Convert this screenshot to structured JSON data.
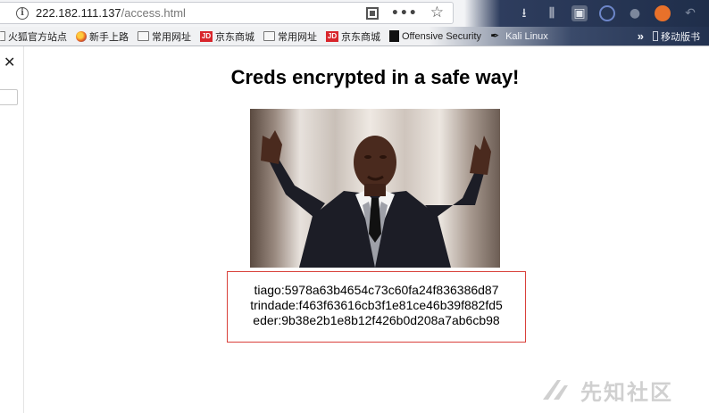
{
  "browser": {
    "url_host": "222.182.111.137",
    "url_path": "/access.html",
    "toolbar_icons": [
      "qr-code-icon",
      "more-icon",
      "bookmark-star-icon",
      "download-icon",
      "library-icon",
      "sidebar-icon",
      "globe-icon",
      "extension-icon",
      "extension-icon",
      "back-icon"
    ]
  },
  "bookmarks": {
    "items": [
      {
        "label": "火狐官方站点",
        "icon": "folder-icon"
      },
      {
        "label": "新手上路",
        "icon": "firefox-icon"
      },
      {
        "label": "常用网址",
        "icon": "folder-icon"
      },
      {
        "label": "京东商城",
        "icon": "jd-icon",
        "icon_text": "JD"
      },
      {
        "label": "常用网址",
        "icon": "folder-icon"
      },
      {
        "label": "京东商城",
        "icon": "jd-icon",
        "icon_text": "JD"
      },
      {
        "label": "Offensive Security",
        "icon": "offensive-security-icon"
      },
      {
        "label": "Kali Linux",
        "icon": "kali-icon"
      }
    ],
    "overflow_label": "»",
    "mobile_label": "移动版书"
  },
  "side_panel": {
    "close_label": "✕"
  },
  "page": {
    "title": "Creds encrypted in a safe way!",
    "image_alt": "man-in-suit-raising-hands",
    "creds": [
      "tiago:5978a63b4654c73c60fa24f836386d87",
      "trindade:f463f63616cb3f1e81ce46b39f882fd5",
      "eder:9b38e2b1e8b12f426b0d208a7ab6cb98"
    ]
  },
  "watermark": {
    "text": "先知社区"
  },
  "colors": {
    "creds_border": "#d9403a",
    "toolbar_dark": "#1f2e4a",
    "jd_red": "#d8262c"
  }
}
